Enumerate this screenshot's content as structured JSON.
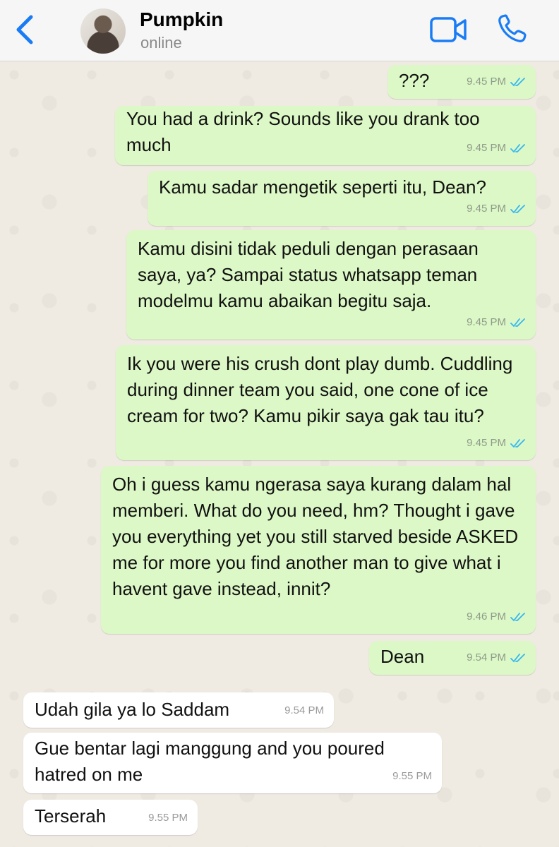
{
  "header": {
    "contact_name": "Pumpkin",
    "status": "online",
    "accent_color": "#1a7cf5"
  },
  "messages": [
    {
      "direction": "out",
      "text": "???",
      "time": "9.45 PM",
      "status": "read"
    },
    {
      "direction": "out",
      "text": "You had a drink? Sounds like you drank too much",
      "time": "9.45 PM",
      "status": "read"
    },
    {
      "direction": "out",
      "text": "Kamu sadar mengetik seperti itu, Dean?",
      "time": "9.45 PM",
      "status": "read"
    },
    {
      "direction": "out",
      "text": "Kamu disini tidak peduli dengan perasaan saya, ya? Sampai status whatsapp teman modelmu kamu abaikan begitu saja.",
      "time": "9.45 PM",
      "status": "read"
    },
    {
      "direction": "out",
      "text": "Ik you were his crush dont play dumb. Cuddling during dinner team you said, one cone of ice cream for two? Kamu pikir saya gak tau itu?",
      "time": "9.45 PM",
      "status": "read"
    },
    {
      "direction": "out",
      "text": "Oh i guess kamu ngerasa saya kurang dalam hal memberi. What do you need, hm? Thought i gave you everything yet you still starved beside ASKED me for more you find another man to give what i havent gave instead, innit?",
      "time": "9.46 PM",
      "status": "read"
    },
    {
      "direction": "out",
      "text": "Dean",
      "time": "9.54 PM",
      "status": "read"
    },
    {
      "direction": "in",
      "text": "Udah gila ya lo Saddam",
      "time": "9.54 PM"
    },
    {
      "direction": "in",
      "text": "Gue bentar lagi manggung and you poured hatred on me",
      "time": "9.55 PM"
    },
    {
      "direction": "in",
      "text": "Terserah",
      "time": "9.55 PM"
    }
  ]
}
